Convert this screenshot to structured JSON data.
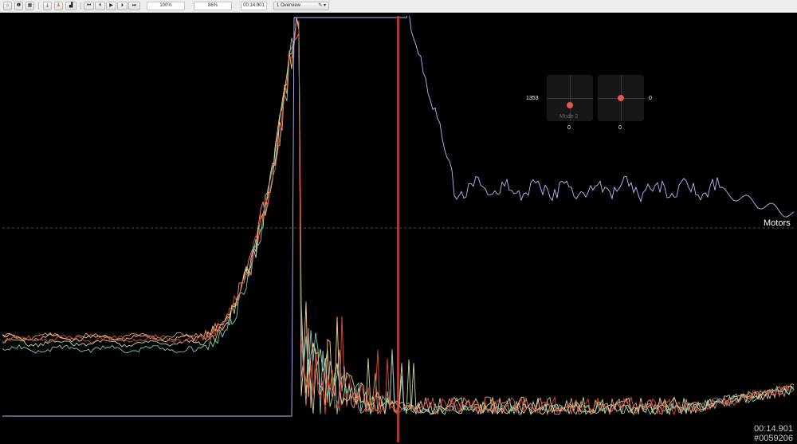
{
  "toolbar": {
    "buttons": [
      {
        "name": "home-button",
        "icon": "home-icon",
        "glyph": "⌂"
      },
      {
        "name": "info-button",
        "icon": "info-icon",
        "glyph": "❶"
      },
      {
        "name": "calculator-button",
        "icon": "calculator-icon",
        "glyph": "▦"
      },
      {
        "name": "download-button",
        "icon": "download-icon",
        "glyph": "⤓"
      },
      {
        "name": "person-button",
        "icon": "person-icon",
        "glyph": "♟"
      },
      {
        "name": "chart-button",
        "icon": "bar-chart-icon",
        "glyph": "▟"
      },
      {
        "name": "skip-start-button",
        "icon": "skip-start-icon",
        "glyph": "⏮"
      },
      {
        "name": "step-back-button",
        "icon": "step-back-icon",
        "glyph": "⏴"
      },
      {
        "name": "play-button",
        "icon": "play-icon",
        "glyph": "▶"
      },
      {
        "name": "step-forward-button",
        "icon": "step-forward-icon",
        "glyph": "⏵"
      },
      {
        "name": "skip-end-button",
        "icon": "skip-end-icon",
        "glyph": "⏭"
      }
    ],
    "zoom_value": "100%",
    "smoothing_value": "86%",
    "time_value": "00:14.901",
    "view_select": "1 Overview",
    "view_menu_glyph": "✎ ▾"
  },
  "sticks": {
    "left": {
      "x_value": "1353",
      "y_value": "0",
      "mode_label": "Mode 2"
    },
    "right": {
      "x_value": "0",
      "y_value": "0"
    }
  },
  "graph": {
    "motors_label": "Motors",
    "time": "00:14.901",
    "frame": "#0059206"
  },
  "colors": {
    "cursor": "#d2453c",
    "gridline": "#666666",
    "motor_series": [
      "#e9967a",
      "#f4cf8a",
      "#c8dc9a",
      "#7ec8c0",
      "#e04a3a",
      "#b9b9ff"
    ]
  }
}
